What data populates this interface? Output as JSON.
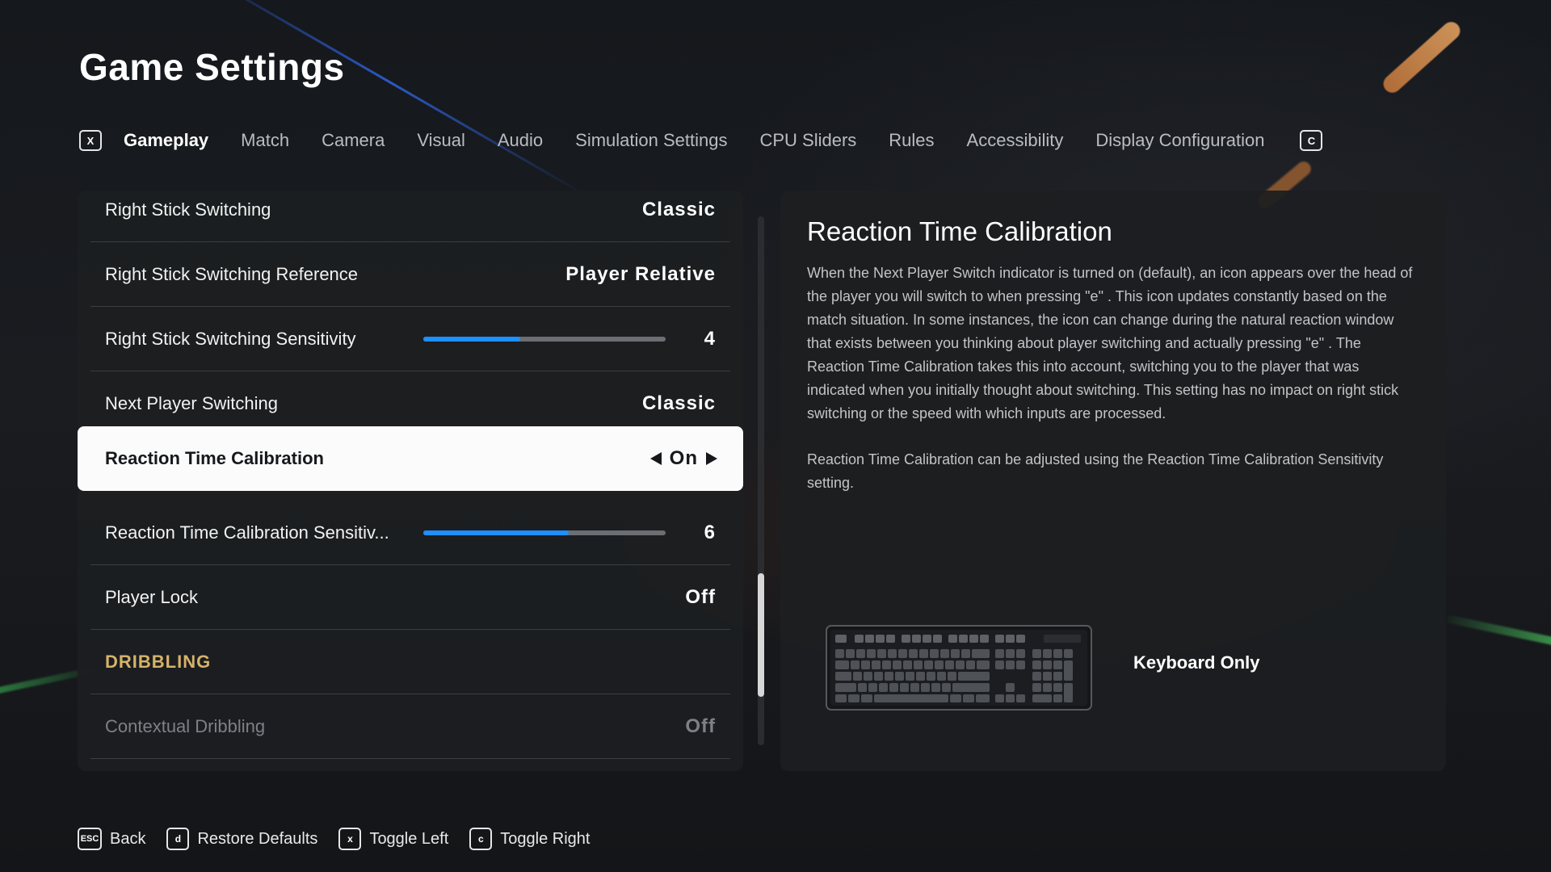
{
  "page": {
    "title": "Game Settings"
  },
  "tabs": {
    "left_key": "X",
    "right_key": "C",
    "items": [
      {
        "label": "Gameplay",
        "active": true
      },
      {
        "label": "Match"
      },
      {
        "label": "Camera"
      },
      {
        "label": "Visual"
      },
      {
        "label": "Audio"
      },
      {
        "label": "Simulation Settings"
      },
      {
        "label": "CPU Sliders"
      },
      {
        "label": "Rules"
      },
      {
        "label": "Accessibility"
      },
      {
        "label": "Display Configuration"
      }
    ]
  },
  "settings": {
    "rows": [
      {
        "label": "Right Stick Switching",
        "value": "Classic"
      },
      {
        "label": "Right Stick Switching Reference",
        "value": "Player Relative"
      },
      {
        "label": "Right Stick Switching Sensitivity",
        "value": "4",
        "slider": 0.4
      },
      {
        "label": "Next Player Switching",
        "value": "Classic"
      },
      {
        "label": "Reaction Time Calibration",
        "value": "On",
        "selected": true
      },
      {
        "label": "Reaction Time Calibration Sensitiv...",
        "value": "6",
        "slider": 0.6
      },
      {
        "label": "Player Lock",
        "value": "Off"
      },
      {
        "label": "DRIBBLING",
        "section": true
      },
      {
        "label": "Contextual Dribbling",
        "value": "Off",
        "disabled": true
      }
    ]
  },
  "description": {
    "title": "Reaction Time Calibration",
    "paragraphs": [
      "When the Next Player Switch indicator is turned on (default), an icon appears over the head of the player you will switch to when pressing \"e\" . This icon updates constantly based on the match situation. In some instances, the icon can change during the natural reaction window that exists between you thinking about player switching and actually pressing \"e\" . The Reaction Time Calibration takes this into account, switching you to the player that was indicated when you initially thought about switching. This setting has no impact on right stick switching or the speed with which inputs are processed.",
      "Reaction Time Calibration can be adjusted using the Reaction Time Calibration Sensitivity setting."
    ],
    "input_device": "Keyboard Only"
  },
  "footer": {
    "hints": [
      {
        "key": "ESC",
        "label": "Back"
      },
      {
        "key": "d",
        "label": "Restore Defaults"
      },
      {
        "key": "x",
        "label": "Toggle Left"
      },
      {
        "key": "c",
        "label": "Toggle Right"
      }
    ]
  },
  "colors": {
    "accent": "#1e8fff",
    "section": "#d6b26a",
    "selected_row": "#fbfbfb"
  }
}
